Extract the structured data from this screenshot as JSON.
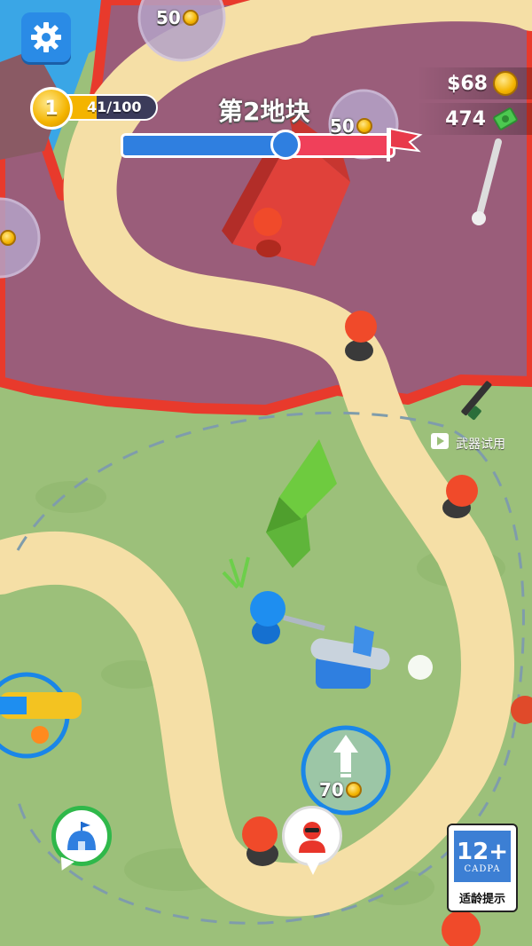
{
  "hud": {
    "level": "1",
    "xp": "41/100",
    "zone_title": "第2地块",
    "money": "$68",
    "cash": "474"
  },
  "buildings": {
    "top_cost": "50",
    "mid_cost": "50",
    "upgrade_cost": "70"
  },
  "weapon_trial": {
    "label": "武器试用"
  },
  "age_rating": {
    "number": "12+",
    "org": "CADPA",
    "text": "适龄提示"
  },
  "progress": {
    "fraction": 0.6
  },
  "colors": {
    "enemy_ground": "#9a5d7a",
    "border": "#e83a2c",
    "grass": "#9cc07a",
    "path": "#f5dfa6",
    "player": "#1e8ef0"
  }
}
